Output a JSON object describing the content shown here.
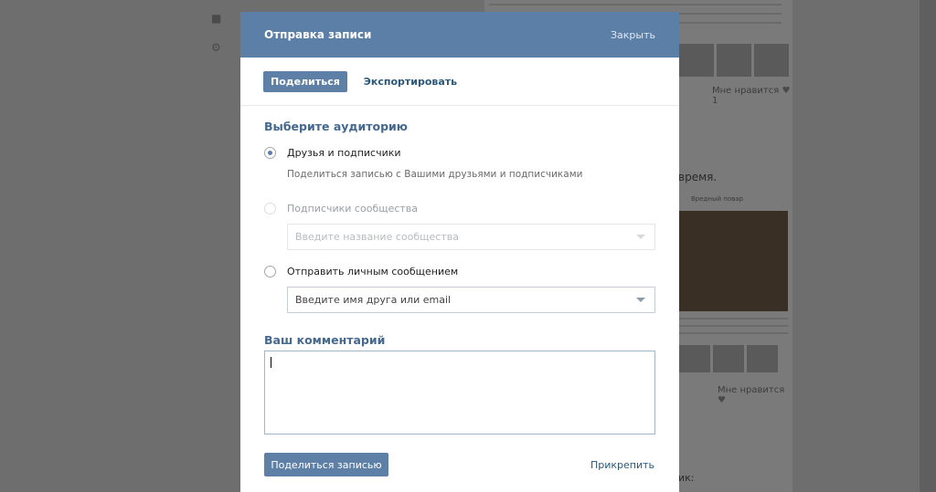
{
  "background": {
    "likes_label_1": "Мне нравится",
    "likes_count_1": "1",
    "feed_text": "время.",
    "pic_caption": "Вредный повар",
    "likes_label_2": "Мне нравится",
    "bottom_text": "ик:"
  },
  "modal": {
    "title": "Отправка записи",
    "close_label": "Закрыть",
    "tabs": [
      {
        "label": "Поделиться",
        "active": true
      },
      {
        "label": "Экспортировать",
        "active": false
      }
    ],
    "audience_title": "Выберите аудиторию",
    "options": {
      "friends": {
        "label": "Друзья и подписчики",
        "hint": "Поделиться записью с Вашими друзьями и подписчиками",
        "checked": true
      },
      "community": {
        "label": "Подписчики сообщества",
        "placeholder": "Введите название сообщества",
        "disabled": true
      },
      "message": {
        "label": "Отправить личным сообщением",
        "placeholder": "Введите имя друга или email"
      }
    },
    "comment_title": "Ваш комментарий",
    "comment_value": "",
    "share_button": "Поделиться записью",
    "attach_link": "Прикрепить"
  },
  "colors": {
    "header_bg": "#5b7fa6",
    "accent_text": "#45688e",
    "overlay": "#6e6e6e"
  }
}
